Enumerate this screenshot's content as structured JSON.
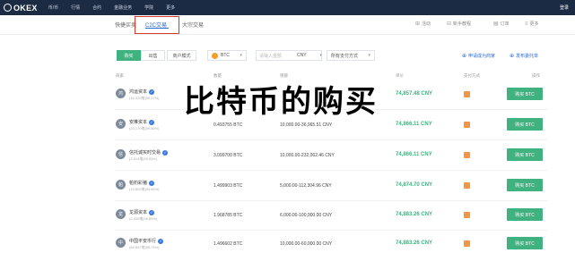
{
  "brand": {
    "logo_text": "OKEX"
  },
  "topnav": [
    "币/币",
    "行情",
    "合约",
    "金融业务",
    "学院",
    "更多"
  ],
  "topbar": {
    "login_label": "登录"
  },
  "subnav": {
    "tabs": [
      "快捷买卖",
      "C2C交易",
      "大宗交易"
    ],
    "active_tab": "C2C交易",
    "right_links": [
      "活动",
      "新手教程",
      "订单",
      "更多"
    ]
  },
  "filters": {
    "buy_label": "购买",
    "sell_label": "出售",
    "merchant_mode_label": "商户模式",
    "coin_select_value": "BTC",
    "amount_placeholder": "请输入金额",
    "currency_select_value": "CNY",
    "payment_select_value": "所有支付方式",
    "apply_merchant_link": "申请成为商家",
    "post_ad_link": "发布委托单"
  },
  "table_headers": [
    "商家",
    "数量",
    "限额",
    "单价",
    "支付方式",
    "操作"
  ],
  "rows": [
    {
      "avatar": "鸿",
      "name": "鸿运资本",
      "stats": "(16,329笔|99.27%)",
      "qty": "",
      "limit": "",
      "price": "74,857.48 CNY",
      "action": "购买 BTC"
    },
    {
      "avatar": "安",
      "name": "安推资本",
      "stats": "(25,170笔|99.56%)",
      "qty": "0.493755 BTC",
      "limit": "10,000.00-36,965.51 CNY",
      "price": "74,866.11 CNY",
      "action": "购买 BTC"
    },
    {
      "avatar": "信",
      "name": "信托诚实时交易",
      "stats": "(2,518笔|99.53%)",
      "qty": "3.099700 BTC",
      "limit": "10,000.00-232,062.46 CNY",
      "price": "74,866.11 CNY",
      "action": "购买 BTC"
    },
    {
      "avatar": "帕",
      "name": "帕钓彩猪",
      "stats": "(19,603笔|99.66%)",
      "qty": "1.499903 BTC",
      "limit": "5,000.00-112,304.96 CNY",
      "price": "74,874.70 CNY",
      "action": "购买 BTC"
    },
    {
      "avatar": "龙",
      "name": "龙源资本",
      "stats": "(2,430笔|99.89%)",
      "qty": "1.968785 BTC",
      "limit": "6,000.00-100,000.00 CNY",
      "price": "74,883.26 CNY",
      "action": "购买 BTC"
    },
    {
      "avatar": "中",
      "name": "中国平安币行",
      "stats": "(66,657笔|99.74%)",
      "qty": "1.496602 BTC",
      "limit": "10,000.00-60,000.00 CNY",
      "price": "74,883.26 CNY",
      "action": "购买 BTC"
    }
  ],
  "overlay_title": "比特币的购买",
  "colors": {
    "accent_green": "#3fb27f",
    "nav_dark": "#1b2b44",
    "link_blue": "#2b6ad1",
    "highlight_red": "#d9382f",
    "pay_orange": "#f29544"
  }
}
